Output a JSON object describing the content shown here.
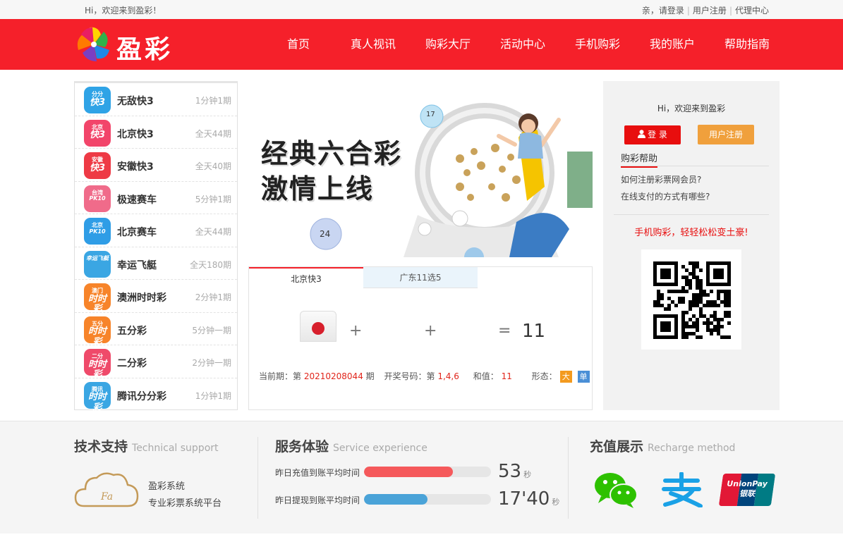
{
  "topbar": {
    "greeting": "Hi，欢迎来到盈彩！",
    "login_prompt": "亲，请登录",
    "register": "用户注册",
    "agent": "代理中心"
  },
  "header": {
    "logo_text": "盈彩",
    "nav": [
      "首页",
      "真人视讯",
      "购彩大厅",
      "活动中心",
      "手机购彩",
      "我的账户",
      "帮助指南"
    ]
  },
  "sidebar": {
    "items": [
      {
        "name": "无敌快3",
        "period": "1分钟1期",
        "icon_top": "分分",
        "icon_main": "快3",
        "color": "#2fa3e6"
      },
      {
        "name": "北京快3",
        "period": "全天44期",
        "icon_top": "北京",
        "icon_main": "快3",
        "color": "#f2456a"
      },
      {
        "name": "安徽快3",
        "period": "全天40期",
        "icon_top": "安徽",
        "icon_main": "快3",
        "color": "#ee3a45"
      },
      {
        "name": "极速赛车",
        "period": "5分钟1期",
        "icon_top": "台湾",
        "icon_main": "PK10",
        "color": "#f06b8a"
      },
      {
        "name": "北京赛车",
        "period": "全天44期",
        "icon_top": "北京",
        "icon_main": "PK10",
        "color": "#2f9de6"
      },
      {
        "name": "幸运飞艇",
        "period": "全天180期",
        "icon_top": "",
        "icon_main": "幸运飞艇",
        "color": "#3aa6e3"
      },
      {
        "name": "澳洲时时彩",
        "period": "2分钟1期",
        "icon_top": "澳门",
        "icon_main": "时时彩",
        "color": "#f7842a"
      },
      {
        "name": "五分彩",
        "period": "5分钟一期",
        "icon_top": "五分",
        "icon_main": "时时彩",
        "color": "#f7842a"
      },
      {
        "name": "二分彩",
        "period": "2分钟一期",
        "icon_top": "二分",
        "icon_main": "时时彩",
        "color": "#ef4a6a"
      },
      {
        "name": "腾讯分分彩",
        "period": "1分钟1期",
        "icon_top": "腾讯",
        "icon_main": "时时彩",
        "color": "#3aa6e3"
      }
    ]
  },
  "banner": {
    "line1": "经典六合彩",
    "line2": "激情上线",
    "ball1": "17",
    "ball2": "24"
  },
  "lottery": {
    "tabs": [
      "北京快3",
      "广东11选5"
    ],
    "plus": "+",
    "equals": "=",
    "sum": "11",
    "period_label": "当前期：第",
    "period_num": "20210208044",
    "period_suffix": "期",
    "numbers_label": "开奖号码：第",
    "numbers": "1,4,6",
    "sum_label": "和值：",
    "sum_value": "11",
    "shape_label": "形态：",
    "badge_big": "大",
    "badge_odd": "单",
    "badge_big_color": "#f39a1e",
    "badge_odd_color": "#4a8fd6"
  },
  "right_panel": {
    "hi": "Hi，欢迎来到盈彩",
    "login_btn": "登 录",
    "register_btn": "用户注册",
    "help_title": "购彩帮助",
    "q1": "如何注册彩票网会员?",
    "q2": "在线支付的方式有哪些?",
    "slogan": "手机购彩，轻轻松松变土豪!"
  },
  "footer": {
    "tech_title": "技术支持",
    "tech_sub": "Technical support",
    "cloud_text": "Fa",
    "sys_name": "盈彩系统",
    "sys_desc": "专业彩票系统平台",
    "service_title": "服务体验",
    "service_sub": "Service experience",
    "deposit_label": "昨日充值到账平均时间",
    "deposit_value": "53",
    "deposit_unit": "秒",
    "deposit_fill": 0.7,
    "withdraw_label": "昨日提现到账平均时间",
    "withdraw_value": "17'40",
    "withdraw_unit": "秒",
    "withdraw_fill": 0.5,
    "recharge_title": "充值展示",
    "recharge_sub": "Recharge method",
    "unionpay_top": "UnionPay",
    "unionpay_bottom": "银联"
  },
  "colors": {
    "brand_red": "#f5202a",
    "bar_red": "#f5595b",
    "bar_blue": "#4aa3d8"
  }
}
